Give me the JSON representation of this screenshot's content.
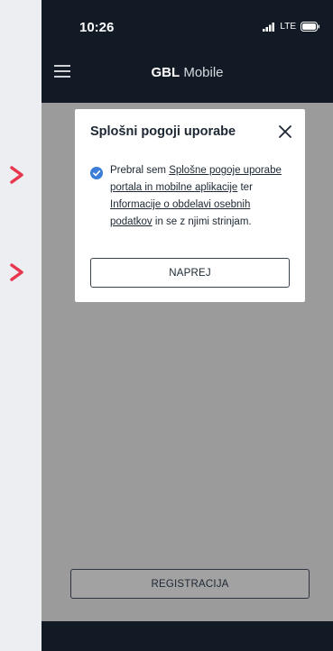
{
  "status_bar": {
    "time": "10:26",
    "carrier": "LTE",
    "icons": [
      "signal-icon",
      "battery-icon"
    ]
  },
  "header": {
    "title_bold": "GBL",
    "title_rest": " Mobile",
    "menu_icon": "hamburger-menu-icon"
  },
  "annotations": {
    "markers": [
      "chevron-right-icon",
      "chevron-right-icon"
    ],
    "color": "#e8364f"
  },
  "modal": {
    "title": "Splošni pogoji uporabe",
    "close_icon": "close-icon",
    "consent": {
      "checked": true,
      "text_before": "Prebral sem ",
      "link1": "Splošne pogoje uporabe portala in mobilne aplikacije",
      "text_middle": " ter ",
      "link2": "Informacije o obdelavi osebnih podatkov",
      "text_after": " in se z njimi strinjam."
    },
    "primary_button": "NAPREJ"
  },
  "main": {
    "register_button": "REGISTRACIJA"
  },
  "colors": {
    "dark": "#121b25",
    "overlay": "#9b9b9b",
    "accent_blue": "#3b7dd8",
    "page_bg": "#eceef1"
  }
}
